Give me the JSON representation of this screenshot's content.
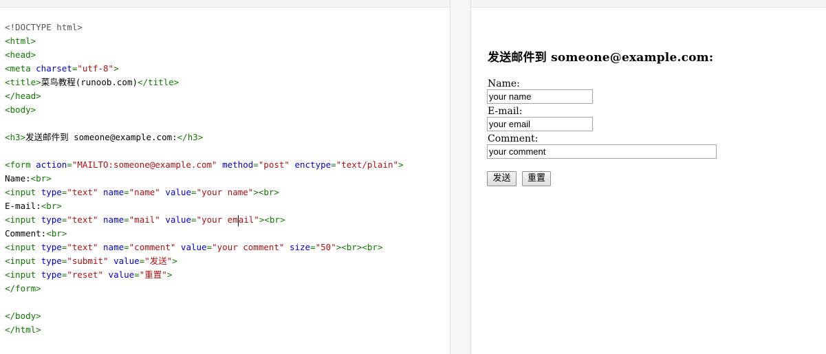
{
  "editor": {
    "lines": [
      [
        {
          "t": "<!DOCTYPE html>",
          "c": "dt"
        }
      ],
      [
        {
          "t": "<html>",
          "c": "tg"
        }
      ],
      [
        {
          "t": "<head>",
          "c": "tg"
        }
      ],
      [
        {
          "t": "<meta ",
          "c": "tg"
        },
        {
          "t": "charset",
          "c": "at"
        },
        {
          "t": "=",
          "c": "tg"
        },
        {
          "t": "\"utf-8\"",
          "c": "st"
        },
        {
          "t": ">",
          "c": "tg"
        }
      ],
      [
        {
          "t": "<title>",
          "c": "tg"
        },
        {
          "t": "菜鸟教程(runoob.com)",
          "c": ""
        },
        {
          "t": "</title>",
          "c": "tg"
        }
      ],
      [
        {
          "t": "</head>",
          "c": "tg"
        }
      ],
      [
        {
          "t": "<body>",
          "c": "tg"
        }
      ],
      [],
      [
        {
          "t": "<h3>",
          "c": "tg"
        },
        {
          "t": "发送邮件到 someone@example.com:",
          "c": ""
        },
        {
          "t": "</h3>",
          "c": "tg"
        }
      ],
      [],
      [
        {
          "t": "<form ",
          "c": "tg"
        },
        {
          "t": "action",
          "c": "at"
        },
        {
          "t": "=",
          "c": "tg"
        },
        {
          "t": "\"MAILTO:someone@example.com\"",
          "c": "st"
        },
        {
          "t": " ",
          "c": ""
        },
        {
          "t": "method",
          "c": "at"
        },
        {
          "t": "=",
          "c": "tg"
        },
        {
          "t": "\"post\"",
          "c": "st"
        },
        {
          "t": " ",
          "c": ""
        },
        {
          "t": "enctype",
          "c": "at"
        },
        {
          "t": "=",
          "c": "tg"
        },
        {
          "t": "\"text/plain\"",
          "c": "st"
        },
        {
          "t": ">",
          "c": "tg"
        }
      ],
      [
        {
          "t": "Name:",
          "c": ""
        },
        {
          "t": "<br>",
          "c": "tg"
        }
      ],
      [
        {
          "t": "<input ",
          "c": "tg"
        },
        {
          "t": "type",
          "c": "at"
        },
        {
          "t": "=",
          "c": "tg"
        },
        {
          "t": "\"text\"",
          "c": "st"
        },
        {
          "t": " ",
          "c": ""
        },
        {
          "t": "name",
          "c": "at"
        },
        {
          "t": "=",
          "c": "tg"
        },
        {
          "t": "\"name\"",
          "c": "st"
        },
        {
          "t": " ",
          "c": ""
        },
        {
          "t": "value",
          "c": "at"
        },
        {
          "t": "=",
          "c": "tg"
        },
        {
          "t": "\"your name\"",
          "c": "st"
        },
        {
          "t": "><br>",
          "c": "tg"
        }
      ],
      [
        {
          "t": "E-mail:",
          "c": ""
        },
        {
          "t": "<br>",
          "c": "tg"
        }
      ],
      [
        {
          "t": "<input ",
          "c": "tg"
        },
        {
          "t": "type",
          "c": "at"
        },
        {
          "t": "=",
          "c": "tg"
        },
        {
          "t": "\"text\"",
          "c": "st"
        },
        {
          "t": " ",
          "c": ""
        },
        {
          "t": "name",
          "c": "at"
        },
        {
          "t": "=",
          "c": "tg"
        },
        {
          "t": "\"mail\"",
          "c": "st"
        },
        {
          "t": " ",
          "c": ""
        },
        {
          "t": "value",
          "c": "at"
        },
        {
          "t": "=",
          "c": "tg"
        },
        {
          "t": "\"your em",
          "c": "st"
        },
        {
          "t": "",
          "c": "caret"
        },
        {
          "t": "ail\"",
          "c": "st"
        },
        {
          "t": "><br>",
          "c": "tg"
        }
      ],
      [
        {
          "t": "Comment:",
          "c": ""
        },
        {
          "t": "<br>",
          "c": "tg"
        }
      ],
      [
        {
          "t": "<input ",
          "c": "tg"
        },
        {
          "t": "type",
          "c": "at"
        },
        {
          "t": "=",
          "c": "tg"
        },
        {
          "t": "\"text\"",
          "c": "st"
        },
        {
          "t": " ",
          "c": ""
        },
        {
          "t": "name",
          "c": "at"
        },
        {
          "t": "=",
          "c": "tg"
        },
        {
          "t": "\"comment\"",
          "c": "st"
        },
        {
          "t": " ",
          "c": ""
        },
        {
          "t": "value",
          "c": "at"
        },
        {
          "t": "=",
          "c": "tg"
        },
        {
          "t": "\"your comment\"",
          "c": "st"
        },
        {
          "t": " ",
          "c": ""
        },
        {
          "t": "size",
          "c": "at"
        },
        {
          "t": "=",
          "c": "tg"
        },
        {
          "t": "\"50\"",
          "c": "st"
        },
        {
          "t": "><br><br>",
          "c": "tg"
        }
      ],
      [
        {
          "t": "<input ",
          "c": "tg"
        },
        {
          "t": "type",
          "c": "at"
        },
        {
          "t": "=",
          "c": "tg"
        },
        {
          "t": "\"submit\"",
          "c": "st"
        },
        {
          "t": " ",
          "c": ""
        },
        {
          "t": "value",
          "c": "at"
        },
        {
          "t": "=",
          "c": "tg"
        },
        {
          "t": "\"发送\"",
          "c": "st"
        },
        {
          "t": ">",
          "c": "tg"
        }
      ],
      [
        {
          "t": "<input ",
          "c": "tg"
        },
        {
          "t": "type",
          "c": "at"
        },
        {
          "t": "=",
          "c": "tg"
        },
        {
          "t": "\"reset\"",
          "c": "st"
        },
        {
          "t": " ",
          "c": ""
        },
        {
          "t": "value",
          "c": "at"
        },
        {
          "t": "=",
          "c": "tg"
        },
        {
          "t": "\"重置\"",
          "c": "st"
        },
        {
          "t": ">",
          "c": "tg"
        }
      ],
      [
        {
          "t": "</form>",
          "c": "tg"
        }
      ],
      [],
      [
        {
          "t": "</body>",
          "c": "tg"
        }
      ],
      [
        {
          "t": "</html>",
          "c": "tg"
        }
      ]
    ]
  },
  "preview": {
    "heading": "发送邮件到 someone@example.com:",
    "name_label": "Name:",
    "name_value": "your name",
    "email_label": "E-mail:",
    "email_value": "your email",
    "comment_label": "Comment:",
    "comment_value": "your comment",
    "submit_label": "发送",
    "reset_label": "重置"
  }
}
